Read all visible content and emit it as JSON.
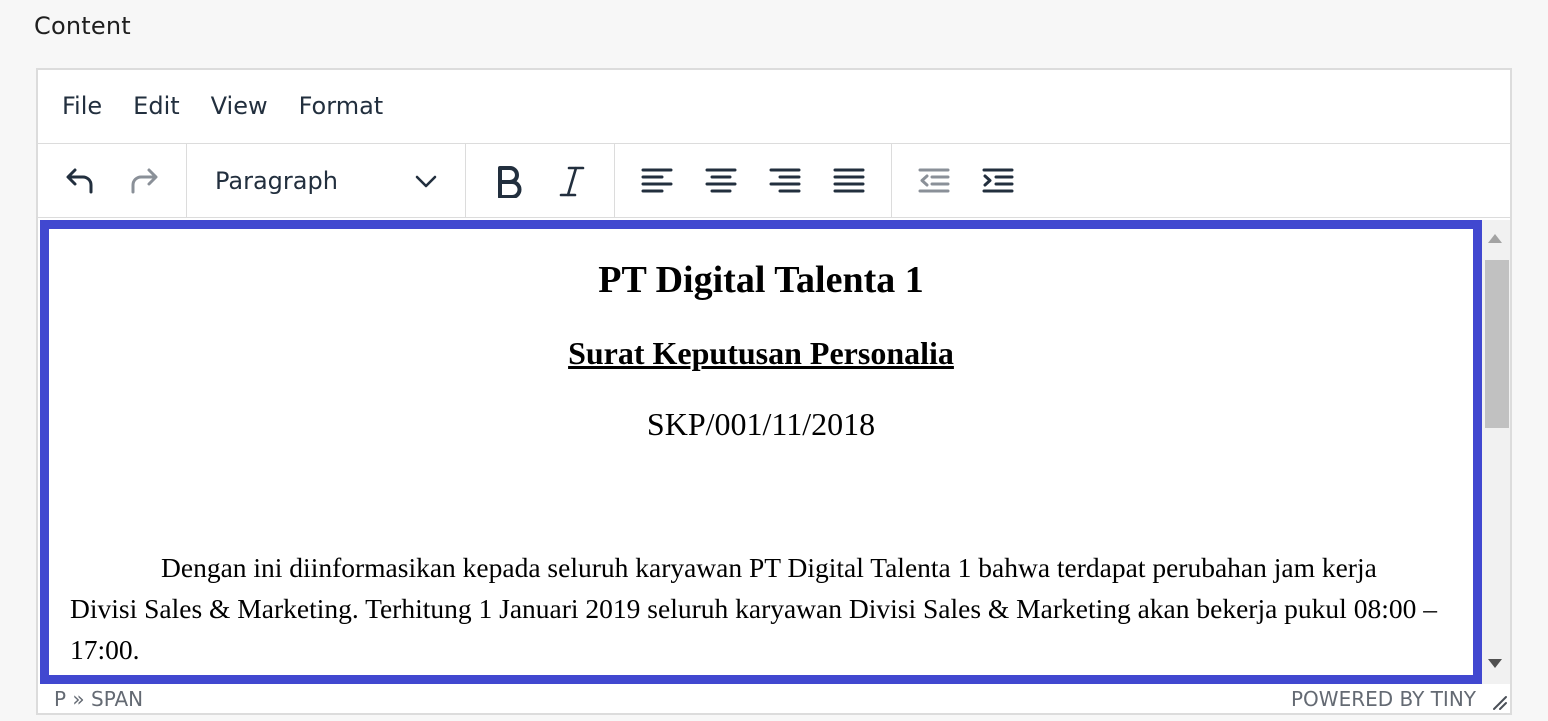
{
  "field": {
    "label": "Content"
  },
  "menubar": {
    "items": [
      "File",
      "Edit",
      "View",
      "Format"
    ]
  },
  "toolbar": {
    "history": [
      "undo-icon",
      "redo-icon"
    ],
    "block_format": {
      "value": "Paragraph"
    },
    "formatting": [
      "bold-icon",
      "italic-icon"
    ],
    "alignment": [
      "align-left-icon",
      "align-center-icon",
      "align-right-icon",
      "align-justify-icon"
    ],
    "indent": [
      "outdent-icon",
      "indent-icon"
    ]
  },
  "document": {
    "title": "PT Digital Talenta 1",
    "subtitle": "Surat Keputusan Personalia",
    "number": "SKP/001/11/2018",
    "body": "Dengan ini diinformasikan kepada seluruh karyawan PT Digital Talenta 1 bahwa terdapat perubahan jam kerja Divisi Sales & Marketing. Terhitung 1 Januari 2019 seluruh karyawan Divisi Sales & Marketing akan bekerja pukul 08:00 – 17:00."
  },
  "statusbar": {
    "path": "P » SPAN",
    "branding": "POWERED BY TINY"
  },
  "colors": {
    "focus_border": "#4148d0",
    "icon": "#222f3e",
    "icon_disabled": "#8a9098"
  }
}
